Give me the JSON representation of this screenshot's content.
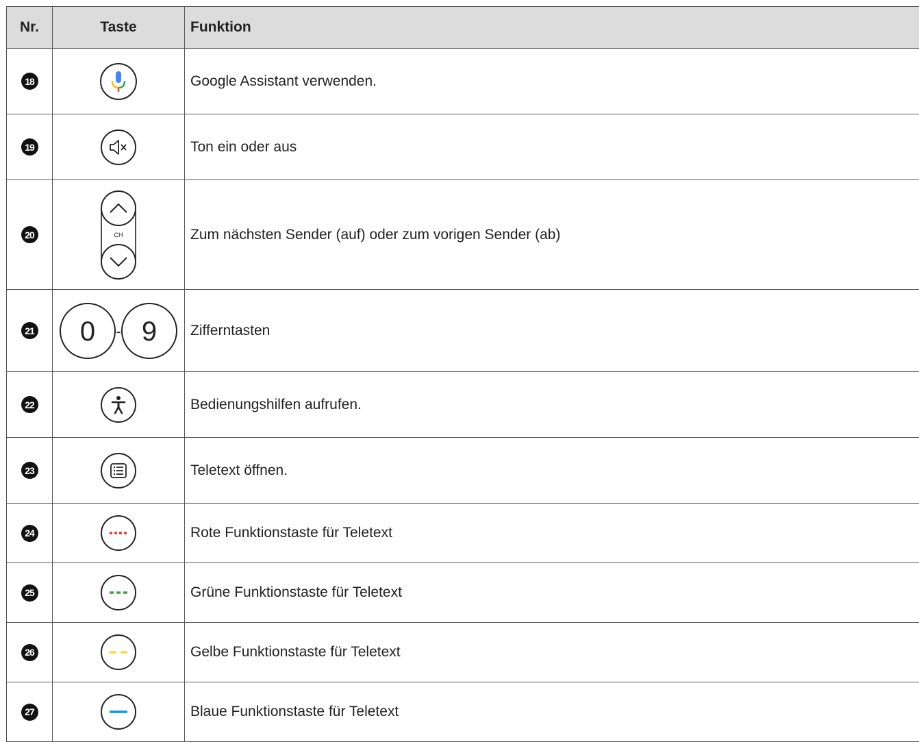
{
  "table": {
    "headers": {
      "nr": "Nr.",
      "key": "Taste",
      "function": "Funktion"
    },
    "rows": [
      {
        "nr": "18",
        "key_icon": "microphone-icon",
        "key_text": "",
        "function": "Google Assistant verwenden."
      },
      {
        "nr": "19",
        "key_icon": "mute-icon",
        "key_text": "",
        "function": "Ton ein oder aus"
      },
      {
        "nr": "20",
        "key_icon": "channel-up-down-icon",
        "key_text": "CH",
        "function": "Zum nächsten Sender (auf) oder zum vorigen Sender (ab)"
      },
      {
        "nr": "21",
        "key_icon": "digit-keys-icon",
        "key_text": "0 - 9",
        "digit_first": "0",
        "digit_separator": "-",
        "digit_last": "9",
        "function": "Zifferntasten"
      },
      {
        "nr": "22",
        "key_icon": "accessibility-icon",
        "key_text": "",
        "function": "Bedienungshilfen aufrufen."
      },
      {
        "nr": "23",
        "key_icon": "teletext-icon",
        "key_text": "",
        "function": "Teletext öffnen."
      },
      {
        "nr": "24",
        "key_icon": "red-button-icon",
        "key_text": "",
        "function": "Rote Funktionstaste für Teletext",
        "color": "#e53935"
      },
      {
        "nr": "25",
        "key_icon": "green-button-icon",
        "key_text": "",
        "function": "Grüne Funktionstaste für Teletext",
        "color": "#43a047"
      },
      {
        "nr": "26",
        "key_icon": "yellow-button-icon",
        "key_text": "",
        "function": "Gelbe Funktionstaste für Teletext",
        "color": "#fdd835"
      },
      {
        "nr": "27",
        "key_icon": "blue-button-icon",
        "key_text": "",
        "function": "Blaue Funktionstaste für Teletext",
        "color": "#039be5"
      }
    ]
  },
  "colors": {
    "header_bg": "#dcdcdc",
    "border": "#555555",
    "mic_blue": "#4285f4",
    "mic_red": "#ea4335",
    "mic_yellow": "#fbbc05",
    "mic_green": "#34a853"
  }
}
